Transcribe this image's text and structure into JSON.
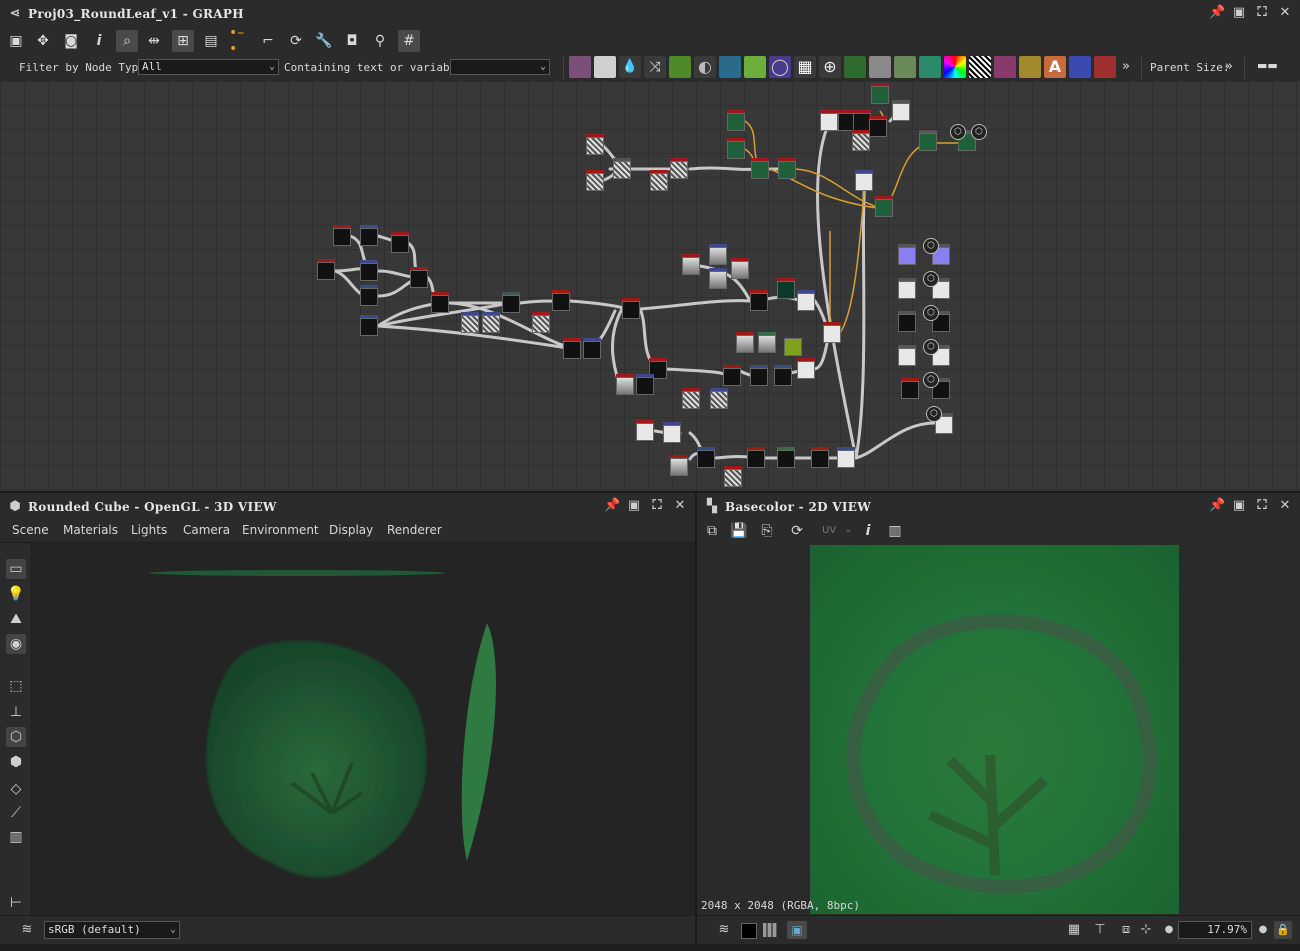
{
  "graph_panel": {
    "title": "Proj03_RoundLeaf_v1 - GRAPH",
    "filter_label": "Filter by Node Type",
    "filter_value": "All",
    "containing_label": "Containing text or variable",
    "containing_value": "",
    "parent_size_label": "Parent Size:",
    "more_glyph": "»"
  },
  "view3d_panel": {
    "title": "Rounded Cube - OpenGL - 3D VIEW",
    "menu": [
      "Scene",
      "Materials",
      "Lights",
      "Camera",
      "Environment",
      "Display",
      "Renderer"
    ],
    "colorspace": "sRGB (default)"
  },
  "view2d_panel": {
    "title": "Basecolor - 2D VIEW",
    "uv_label": "UV",
    "resolution": "2048 x 2048 (RGBA, 8bpc)",
    "zoom": "17.97%"
  },
  "colors": {
    "header_bg": "#2b2b2b",
    "graph_bg": "#383838",
    "node_header_red": "#a01818",
    "node_header_blue": "#3a4a8a",
    "connection": "#c8c8c8",
    "connection_orange": "#d8a030",
    "leaf_green": "#22743a"
  }
}
